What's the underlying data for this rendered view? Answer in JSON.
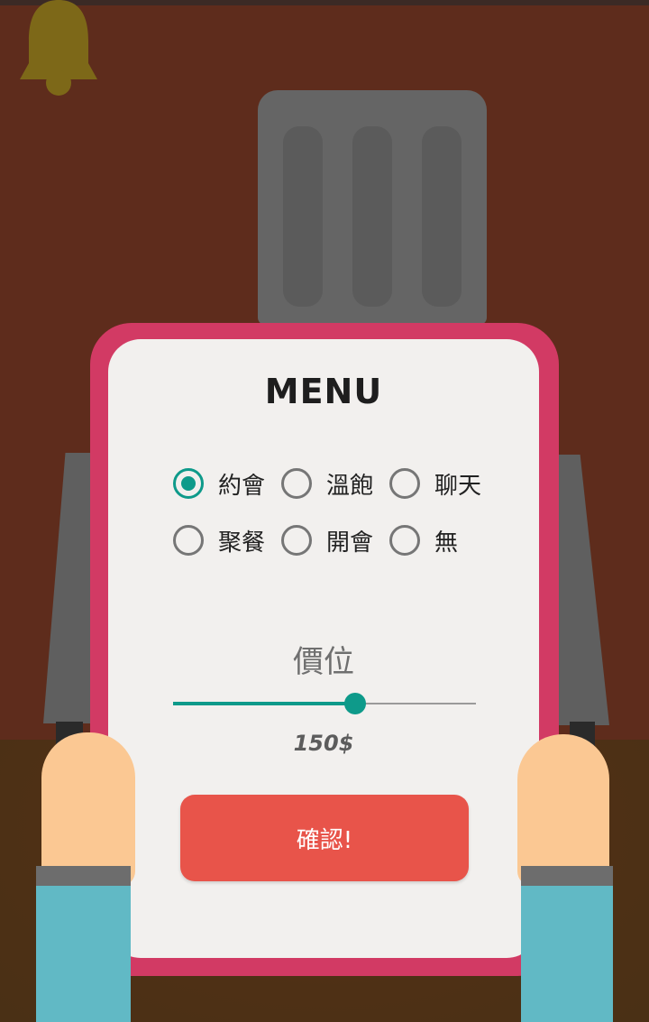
{
  "menu": {
    "title": "MENU",
    "options": [
      {
        "label": "約會",
        "checked": true
      },
      {
        "label": "溫飽",
        "checked": false
      },
      {
        "label": "聊天",
        "checked": false
      },
      {
        "label": "聚餐",
        "checked": false
      },
      {
        "label": "開會",
        "checked": false
      },
      {
        "label": "無",
        "checked": false
      }
    ],
    "price_heading": "價位",
    "price_slider": {
      "fraction": 0.6
    },
    "price_value": "150$",
    "confirm_label": "確認!"
  },
  "colors": {
    "accent": "#0e9a8a",
    "frame": "#d23a64",
    "button": "#e8544a",
    "background": "#5e2c1c"
  },
  "icons": [
    "bell-icon",
    "chef-hat-icon"
  ]
}
